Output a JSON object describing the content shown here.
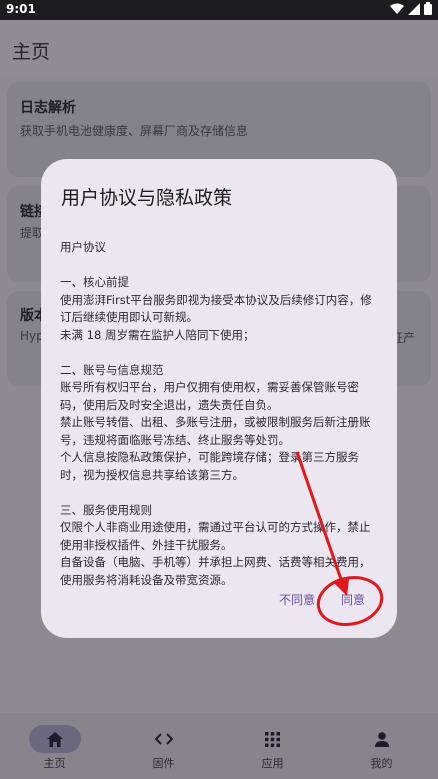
{
  "status": {
    "time": "9:01"
  },
  "appbar": {
    "title": "主页"
  },
  "cards": [
    {
      "title": "日志解析",
      "subtitle": "获取手机电池健康度、屏幕厂商及存储信息"
    },
    {
      "title": "链接",
      "subtitle": "提取"
    },
    {
      "title": "版本",
      "subtitle": "Hyp",
      "subtitle_right": "证产"
    }
  ],
  "dialog": {
    "title": "用户协议与隐私政策",
    "heading": "用户协议",
    "sections": [
      {
        "title": "一、核心前提",
        "lines": [
          "使用澎湃First平台服务即视为接受本协议及后续修订内容，修订后继续使用即认可新规。",
          "未满 18 周岁需在监护人陪同下使用；"
        ]
      },
      {
        "title": "二、账号与信息规范",
        "lines": [
          "账号所有权归平台，用户仅拥有使用权，需妥善保管账号密码，使用后及时安全退出，遗失责任自负。",
          "禁止账号转借、出租、多账号注册，或被限制服务后新注册账号，违规将面临账号冻结、终止服务等处罚。",
          "个人信息按隐私政策保护，可能跨境存储；登录第三方服务时，视为授权信息共享给该第三方。"
        ]
      },
      {
        "title": "三、服务使用规则",
        "lines": [
          "仅限个人非商业用途使用，需通过平台认可的方式操作，禁止使用非授权插件、外挂干扰服务。",
          "自备设备（电脑、手机等）并承担上网费、话费等相关费用，使用服务将消耗设备及带宽资源。"
        ]
      }
    ],
    "buttons": {
      "disagree": "不同意",
      "agree": "同意"
    }
  },
  "navbar": {
    "items": [
      {
        "label": "主页",
        "icon": "home-icon"
      },
      {
        "label": "固件",
        "icon": "code-icon"
      },
      {
        "label": "应用",
        "icon": "apps-icon"
      },
      {
        "label": "我的",
        "icon": "person-icon"
      }
    ]
  },
  "colors": {
    "accent": "#6750a4",
    "annotation": "#e0191e"
  }
}
